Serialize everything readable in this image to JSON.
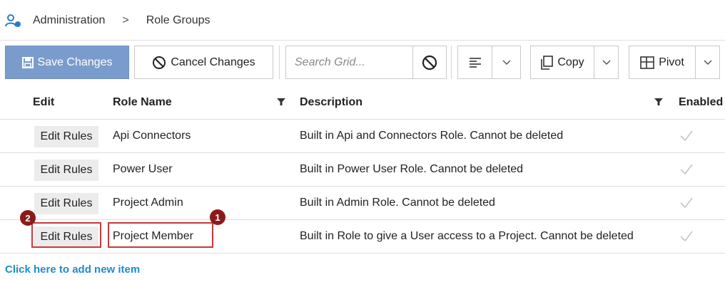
{
  "breadcrumb": {
    "items": [
      "Administration",
      "Role Groups"
    ],
    "separator": ">"
  },
  "toolbar": {
    "save_label": "Save Changes",
    "cancel_label": "Cancel Changes",
    "search_placeholder": "Search Grid...",
    "copy_label": "Copy",
    "pivot_label": "Pivot"
  },
  "grid": {
    "columns": {
      "edit": "Edit",
      "role_name": "Role Name",
      "description": "Description",
      "enabled": "Enabled"
    },
    "rows": [
      {
        "edit": "Edit Rules",
        "role_name": "Api Connectors",
        "description": "Built in Api and Connectors Role. Cannot be deleted",
        "enabled": true
      },
      {
        "edit": "Edit Rules",
        "role_name": "Power User",
        "description": "Built in Power User Role. Cannot be deleted",
        "enabled": true
      },
      {
        "edit": "Edit Rules",
        "role_name": "Project Admin",
        "description": "Built in Admin Role. Cannot be deleted",
        "enabled": true
      },
      {
        "edit": "Edit Rules",
        "role_name": "Project Member",
        "description": "Built in Role to give a User access to a Project. Cannot be deleted",
        "enabled": true
      }
    ],
    "add_link": "Click here to add new item"
  },
  "annotations": {
    "badge_1": "1",
    "badge_2": "2"
  },
  "colors": {
    "primary": "#7a9ccd",
    "link": "#1f8cc8",
    "highlight": "#c8393c",
    "badge": "#8b1b1b"
  }
}
